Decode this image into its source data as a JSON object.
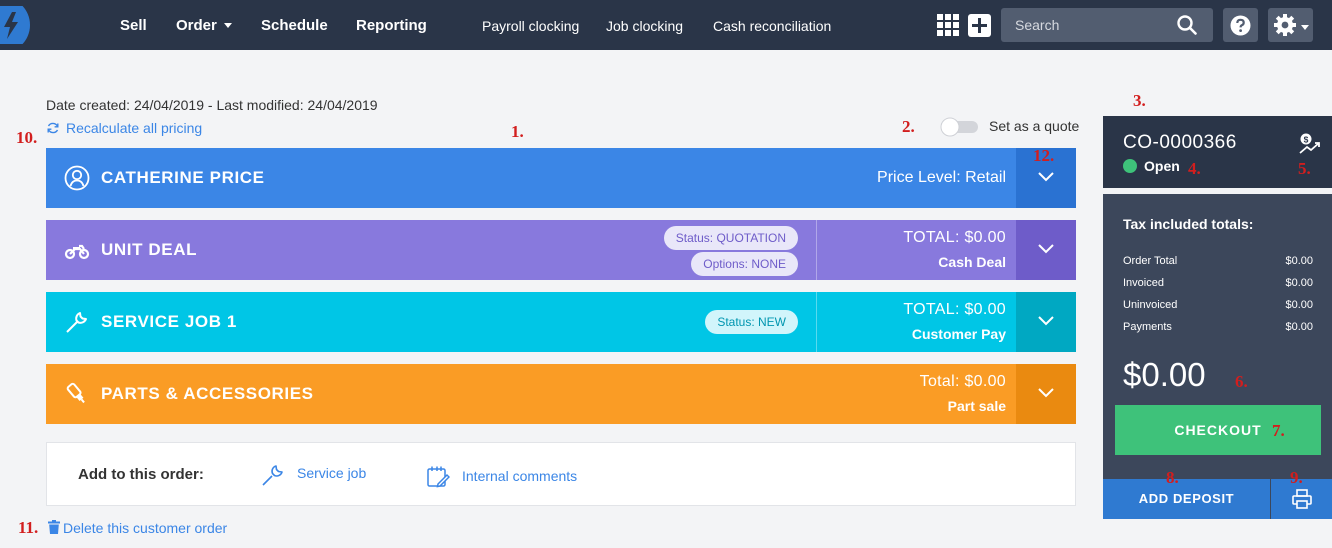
{
  "nav": {
    "main": [
      {
        "label": "Sell"
      },
      {
        "label": "Order",
        "has_caret": true
      },
      {
        "label": "Schedule"
      },
      {
        "label": "Reporting"
      }
    ],
    "sub": [
      {
        "label": "Payroll clocking"
      },
      {
        "label": "Job clocking"
      },
      {
        "label": "Cash reconciliation"
      }
    ],
    "search_placeholder": "Search",
    "icons": [
      "bolt-logo-icon",
      "grid-apps-icon",
      "plus-icon",
      "search-icon",
      "help-icon",
      "gear-icon",
      "chevron-down-icon"
    ]
  },
  "meta": {
    "date_text": "Date created: 24/04/2019 - Last modified: 24/04/2019",
    "recalc_label": "Recalculate all pricing",
    "quote_label": "Set as a quote",
    "quote_on": false
  },
  "annotations": [
    "1.",
    "2.",
    "3.",
    "4.",
    "5.",
    "6.",
    "7.",
    "8.",
    "9.",
    "10.",
    "11.",
    "12."
  ],
  "sections": {
    "customer": {
      "title": "CATHERINE PRICE",
      "right": "Price Level: Retail",
      "color": "#3b86e6",
      "chevron_color": "#2a72d2"
    },
    "unit_deal": {
      "title": "UNIT DEAL",
      "pill_status": "Status: QUOTATION",
      "pill_options": "Options: NONE",
      "total": "TOTAL: $0.00",
      "sub": "Cash Deal",
      "color": "#8879dd",
      "chevron_color": "#6e5cc9"
    },
    "service_job": {
      "title": "SERVICE JOB 1",
      "pill_status": "Status: NEW",
      "total": "TOTAL: $0.00",
      "sub": "Customer Pay",
      "color": "#00c6e6",
      "chevron_color": "#00a8c2"
    },
    "parts": {
      "title": "PARTS & ACCESSORIES",
      "total": "Total: $0.00",
      "sub": "Part sale",
      "color": "#fa9c25",
      "chevron_color": "#ea8a10"
    }
  },
  "add_order": {
    "label": "Add to this order:",
    "service_job": "Service job",
    "internal_comments": "Internal comments"
  },
  "delete_label": "Delete this customer order",
  "panel": {
    "order_no": "CO-0000366",
    "status": "Open",
    "status_color": "#3ec27a",
    "tax_title": "Tax included totals:",
    "rows": [
      {
        "label": "Order Total",
        "value": "$0.00"
      },
      {
        "label": "Invoiced",
        "value": "$0.00"
      },
      {
        "label": "Uninvoiced",
        "value": "$0.00"
      },
      {
        "label": "Payments",
        "value": "$0.00"
      }
    ],
    "big_total": "$0.00",
    "checkout_label": "CHECKOUT",
    "deposit_label": "ADD DEPOSIT"
  }
}
